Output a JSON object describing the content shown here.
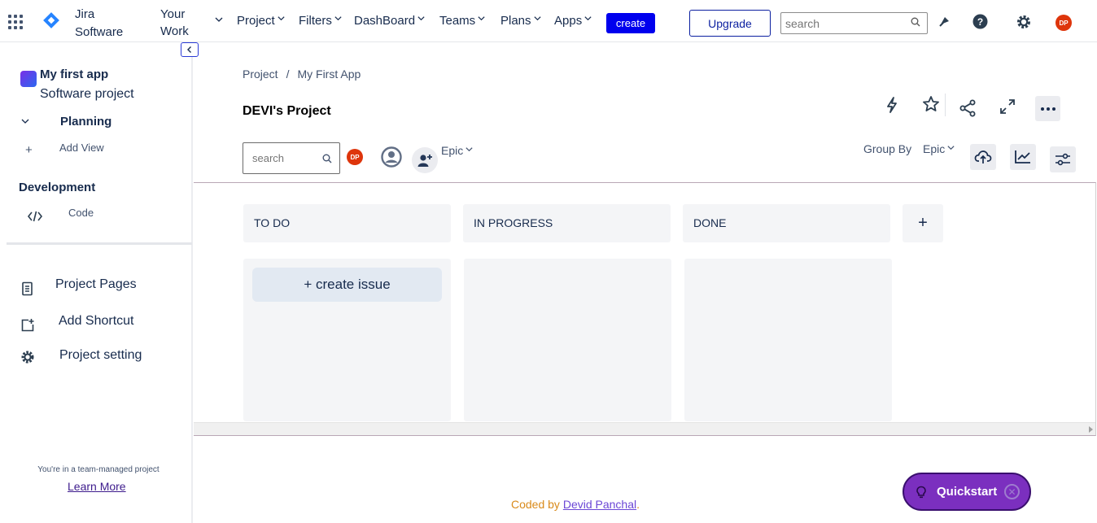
{
  "topnav": {
    "brand_line1": "Jira",
    "brand_line2": "Software",
    "your_work_line1": "Your",
    "your_work_line2": "Work",
    "menus": [
      "Project",
      "Filters",
      "DashBoard",
      "Teams",
      "Plans",
      "Apps"
    ],
    "create_label": "create",
    "upgrade_label": "Upgrade",
    "search_placeholder": "search",
    "avatar_initials": "DP"
  },
  "sidebar": {
    "project_name": "My first app",
    "project_type": "Software project",
    "planning_label": "Planning",
    "add_view_label": "Add View",
    "development_label": "Development",
    "code_label": "Code",
    "links": [
      "Project Pages",
      "Add Shortcut",
      "Project setting"
    ],
    "team_note": "You're in a team-managed project",
    "learn_more": "Learn More"
  },
  "main": {
    "breadcrumb": [
      "Project",
      "/",
      "My First App"
    ],
    "title": "DEVI's Project",
    "search_placeholder": "search",
    "avatar_initials": "DP",
    "epic_label": "Epic",
    "group_by_label": "Group By",
    "group_by_value": "Epic"
  },
  "board": {
    "columns": [
      "TO DO",
      "IN PROGRESS",
      "DONE"
    ],
    "add_column": "+",
    "create_issue": "+ create issue"
  },
  "footer": {
    "credit_prefix": "Coded by ",
    "author": "Devid Panchal",
    "credit_suffix": "."
  },
  "quickstart": {
    "label": "Quickstart",
    "close": "✕"
  },
  "colors": {
    "create_button": "#0000ee",
    "quickstart": "#7b2fbf",
    "avatar": "#de350b"
  }
}
